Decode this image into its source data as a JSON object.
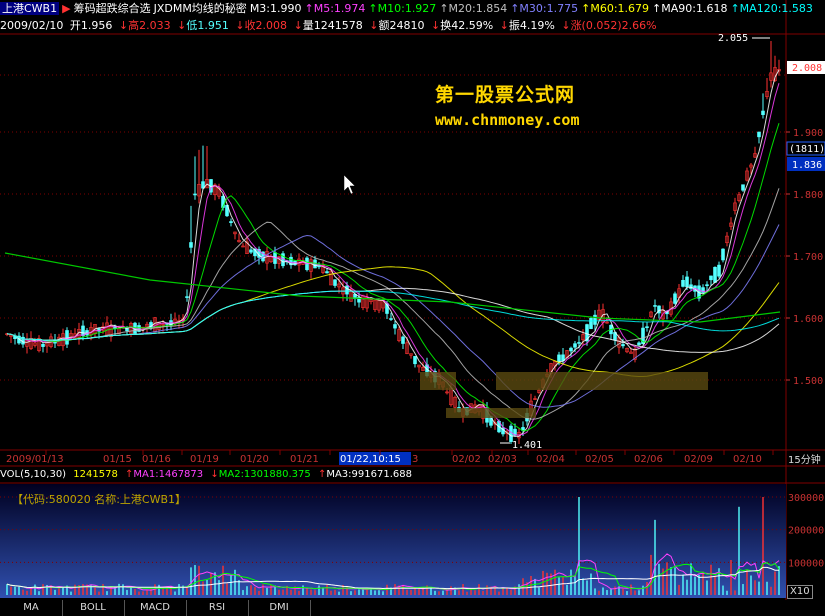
{
  "header": {
    "symbol": "上港CWB1",
    "arrow": "▶",
    "indicator_name": "筹码超跌综合选",
    "formula_name": "JXDMM均线的秘密",
    "ma_values": [
      {
        "label": "M3:1.990",
        "color": "#ffffff"
      },
      {
        "label": "M5:1.974",
        "color": "#ff40ff"
      },
      {
        "label": "M10:1.927",
        "color": "#00ff00"
      },
      {
        "label": "M20:1.854",
        "color": "#c0c0c0"
      },
      {
        "label": "M30:1.775",
        "color": "#8080ff"
      },
      {
        "label": "M60:1.679",
        "color": "#ffff00"
      },
      {
        "label": "MA90:1.618",
        "color": "#ffffff"
      },
      {
        "label": "MA120:1.583",
        "color": "#00ffff"
      }
    ]
  },
  "quote": {
    "date": "2009/02/10",
    "open": "开1.956",
    "high": "高2.033",
    "low": "低1.951",
    "close": "收2.008",
    "volume": "量1241578",
    "amount": "额24810",
    "turnover": "换42.59%",
    "amplitude": "振4.19%",
    "change": "涨(0.052)2.66%"
  },
  "watermark": {
    "title": "第一股票公式网",
    "url": "www.chnmoney.com"
  },
  "price_axis": {
    "ticks": [
      "1.900",
      "1.800",
      "1.700",
      "1.600",
      "1.500"
    ],
    "current_price": "2.008",
    "count_label": "(1811)",
    "cursor_price": "1.836"
  },
  "annotations": {
    "high_label": "2.055",
    "low_label": "1.401"
  },
  "time_axis": {
    "labels": [
      "2009/01/13",
      "01/15",
      "01/16",
      "01/19",
      "01/20",
      "01/21",
      "01/22,10:15",
      "3",
      "02/02",
      "02/03",
      "02/04",
      "02/05",
      "02/06",
      "02/09",
      "02/10"
    ],
    "period": "15分钟"
  },
  "volume_header": {
    "title": "VOL(5,10,30)",
    "value": "1241578",
    "ma1": "MA1:1467873",
    "ma2": "MA2:1301880.375",
    "ma3": "MA3:991671.688"
  },
  "volume_panel": {
    "code_label": "【代码:580020 名称:上港CWB1】",
    "axis_ticks": [
      "300000",
      "200000",
      "100000"
    ],
    "scale": "X10"
  },
  "tabs": [
    "MA",
    "BOLL",
    "MACD",
    "RSI",
    "DMI"
  ],
  "colors": {
    "up": "#ff3232",
    "down": "#54ffff",
    "grid": "#800000",
    "axis_text": "#c83232"
  }
}
